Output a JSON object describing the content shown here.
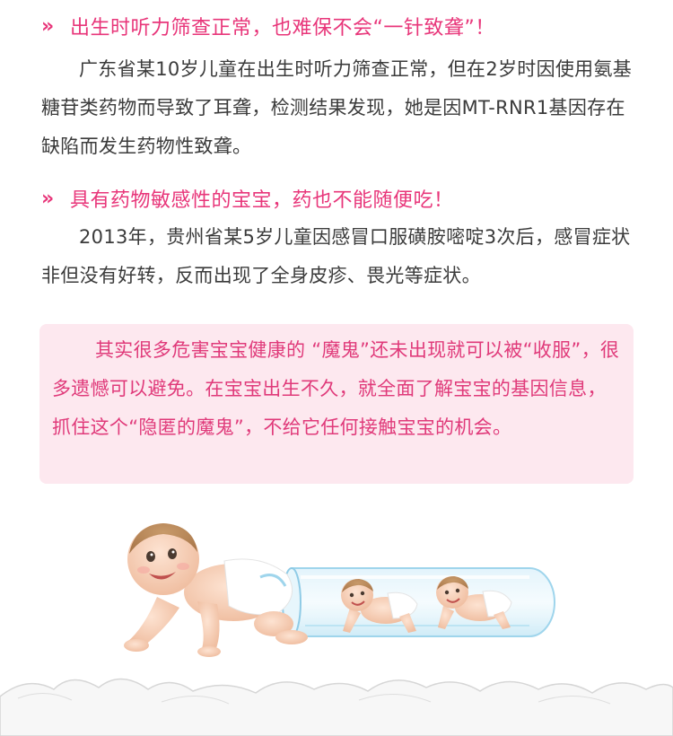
{
  "section1": {
    "icon": "double-chevron-right-icon",
    "heading": "出生时听力筛查正常，也难保不会“一针致聋”！",
    "body": "广东省某10岁儿童在出生时听力筛查正常，但在2岁时因使用氨基糖苷类药物而导致了耳聋，检测结果发现，她是因MT-RNR1基因存在缺陷而发生药物性致聋。"
  },
  "section2": {
    "icon": "double-chevron-right-icon",
    "heading": "具有药物敏感性的宝宝，药也不能随便吃！",
    "body": "2013年，贵州省某5岁儿童因感冒口服磺胺嘧啶3次后，感冒症状非但没有好转，反而出现了全身皮疹、畏光等症状。"
  },
  "callout": {
    "text": "其实很多危害宝宝健康的 “魔鬼”还未出现就可以被“收服”，很多遗憾可以避免。在宝宝出生不久，就全面了解宝宝的基因信息，抓住这个“隐匿的魔鬼”，不给它任何接触宝宝的机会。"
  },
  "colors": {
    "accent": "#e8367a",
    "callout_bg": "#fde8ef",
    "body_text": "#3b3b3b"
  }
}
